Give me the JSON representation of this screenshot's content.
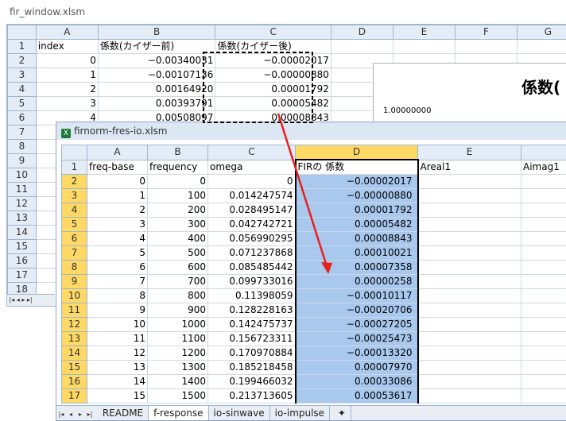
{
  "back_window": {
    "title": "fir_window.xlsm",
    "columns": [
      "A",
      "B",
      "C",
      "D",
      "E",
      "F",
      "G"
    ],
    "rows": [
      {
        "n": "1",
        "a": "index",
        "b": "係数(カイザー前)",
        "c": "係数(カイザー後)"
      },
      {
        "n": "2",
        "a": "0",
        "b": "−0.00340031",
        "c": "−0.00002017"
      },
      {
        "n": "3",
        "a": "1",
        "b": "−0.00107136",
        "c": "−0.00000880"
      },
      {
        "n": "4",
        "a": "2",
        "b": "0.00164920",
        "c": "0.00001792"
      },
      {
        "n": "5",
        "a": "3",
        "b": "0.00393791",
        "c": "0.00005482"
      },
      {
        "n": "6",
        "a": "4",
        "b": "0.00508097",
        "c": "0.00008843"
      },
      {
        "n": "7"
      },
      {
        "n": "8"
      },
      {
        "n": "9"
      },
      {
        "n": "10"
      },
      {
        "n": "11"
      },
      {
        "n": "12"
      },
      {
        "n": "13"
      },
      {
        "n": "14"
      },
      {
        "n": "15"
      },
      {
        "n": "16"
      },
      {
        "n": "17"
      },
      {
        "n": "18"
      }
    ],
    "chart_title": "係数(",
    "chart_axis_label": "1.00000000"
  },
  "front_window": {
    "title": "firnorm-fres-io.xlsm",
    "columns": [
      "A",
      "B",
      "C",
      "D",
      "E"
    ],
    "header_row": {
      "n": "1",
      "a": "freq-base",
      "b": "frequency",
      "c": "omega",
      "d": "FIRの 係数",
      "e": "Areal1",
      "f": "Aimag1"
    },
    "rows": [
      {
        "n": "2",
        "a": "0",
        "b": "0",
        "c": "0",
        "d": "−0.00002017"
      },
      {
        "n": "3",
        "a": "1",
        "b": "100",
        "c": "0.014247574",
        "d": "−0.00000880"
      },
      {
        "n": "4",
        "a": "2",
        "b": "200",
        "c": "0.028495147",
        "d": "0.00001792"
      },
      {
        "n": "5",
        "a": "3",
        "b": "300",
        "c": "0.042742721",
        "d": "0.00005482"
      },
      {
        "n": "6",
        "a": "4",
        "b": "400",
        "c": "0.056990295",
        "d": "0.00008843"
      },
      {
        "n": "7",
        "a": "5",
        "b": "500",
        "c": "0.071237868",
        "d": "0.00010021"
      },
      {
        "n": "8",
        "a": "6",
        "b": "600",
        "c": "0.085485442",
        "d": "0.00007358"
      },
      {
        "n": "9",
        "a": "7",
        "b": "700",
        "c": "0.099733016",
        "d": "0.00000258"
      },
      {
        "n": "10",
        "a": "8",
        "b": "800",
        "c": "0.11398059",
        "d": "−0.00010117"
      },
      {
        "n": "11",
        "a": "9",
        "b": "900",
        "c": "0.128228163",
        "d": "−0.00020706"
      },
      {
        "n": "12",
        "a": "10",
        "b": "1000",
        "c": "0.142475737",
        "d": "−0.00027205"
      },
      {
        "n": "13",
        "a": "11",
        "b": "1100",
        "c": "0.156723311",
        "d": "−0.00025473"
      },
      {
        "n": "14",
        "a": "12",
        "b": "1200",
        "c": "0.170970884",
        "d": "−0.00013320"
      },
      {
        "n": "15",
        "a": "13",
        "b": "1300",
        "c": "0.185218458",
        "d": "0.00007970"
      },
      {
        "n": "16",
        "a": "14",
        "b": "1400",
        "c": "0.199466032",
        "d": "0.00033086"
      },
      {
        "n": "17",
        "a": "15",
        "b": "1500",
        "c": "0.213713605",
        "d": "0.00053617"
      }
    ],
    "tabs": [
      "README",
      "f-response",
      "io-sinwave",
      "io-impulse"
    ],
    "active_tab": "f-response"
  },
  "accent": {
    "arrow": "#e8201c",
    "selection": "#a8c8ee",
    "selected_header": "#ffd966"
  }
}
